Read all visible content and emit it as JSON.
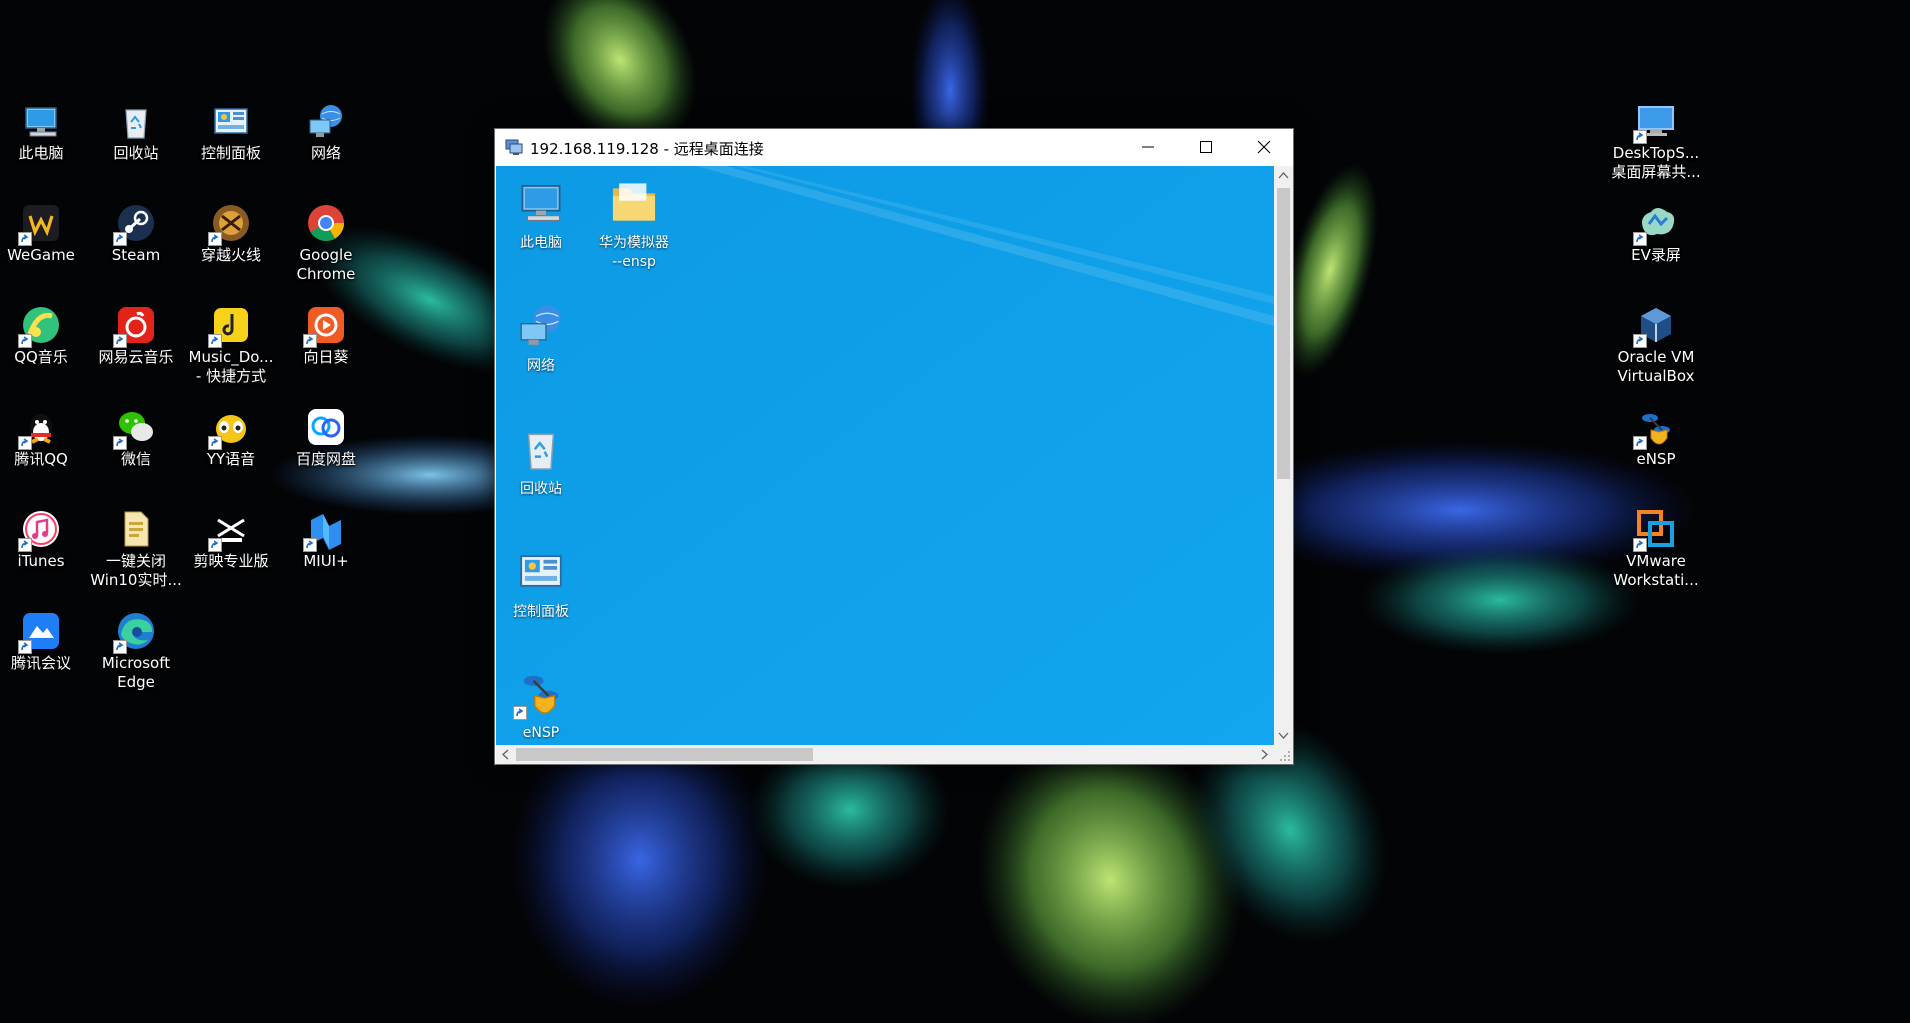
{
  "desktop": {
    "left_icons": [
      {
        "label": "此电脑",
        "icon": "this-pc-icon"
      },
      {
        "label": "回收站",
        "icon": "recycle-bin-icon"
      },
      {
        "label": "控制面板",
        "icon": "control-panel-icon"
      },
      {
        "label": "网络",
        "icon": "network-icon"
      },
      {
        "label": "WeGame",
        "icon": "wegame-icon"
      },
      {
        "label": "Steam",
        "icon": "steam-icon"
      },
      {
        "label": "穿越火线",
        "icon": "crossfire-icon"
      },
      {
        "label": "Google\nChrome",
        "icon": "chrome-icon"
      },
      {
        "label": "QQ音乐",
        "icon": "qq-music-icon"
      },
      {
        "label": "网易云音乐",
        "icon": "netease-music-icon"
      },
      {
        "label": "Music_Do...\n- 快捷方式",
        "icon": "music-shortcut-icon"
      },
      {
        "label": "向日葵",
        "icon": "sunflower-icon"
      },
      {
        "label": "腾讯QQ",
        "icon": "qq-icon"
      },
      {
        "label": "微信",
        "icon": "wechat-icon"
      },
      {
        "label": "YY语音",
        "icon": "yy-icon"
      },
      {
        "label": "百度网盘",
        "icon": "baidu-netdisk-icon"
      },
      {
        "label": "iTunes",
        "icon": "itunes-icon"
      },
      {
        "label": "一键关闭\nWin10实时...",
        "icon": "batch-file-icon"
      },
      {
        "label": "剪映专业版",
        "icon": "capcut-icon"
      },
      {
        "label": "MIUI+",
        "icon": "miui-icon"
      },
      {
        "label": "腾讯会议",
        "icon": "tencent-meeting-icon"
      },
      {
        "label": "Microsoft\nEdge",
        "icon": "edge-icon"
      }
    ],
    "right_icons": [
      {
        "label": "DeskTopS...\n桌面屏幕共...",
        "icon": "desktop-share-icon"
      },
      {
        "label": "EV录屏",
        "icon": "ev-recorder-icon"
      },
      {
        "label": "Oracle VM\nVirtualBox",
        "icon": "virtualbox-icon"
      },
      {
        "label": "eNSP",
        "icon": "ensp-icon"
      },
      {
        "label": "VMware\nWorkstati...",
        "icon": "vmware-icon"
      }
    ]
  },
  "rdp_window": {
    "title": "192.168.119.128 - 远程桌面连接",
    "remote_icons": [
      {
        "label": "此电脑",
        "icon": "this-pc-icon"
      },
      {
        "label": "华为模拟器\n--ensp",
        "icon": "folder-icon"
      },
      {
        "label": "网络",
        "icon": "network-icon"
      },
      {
        "label": "回收站",
        "icon": "recycle-bin-icon"
      },
      {
        "label": "控制面板",
        "icon": "control-panel-icon"
      },
      {
        "label": "eNSP",
        "icon": "ensp-icon"
      }
    ],
    "remote_background": "#0ea2e8"
  }
}
